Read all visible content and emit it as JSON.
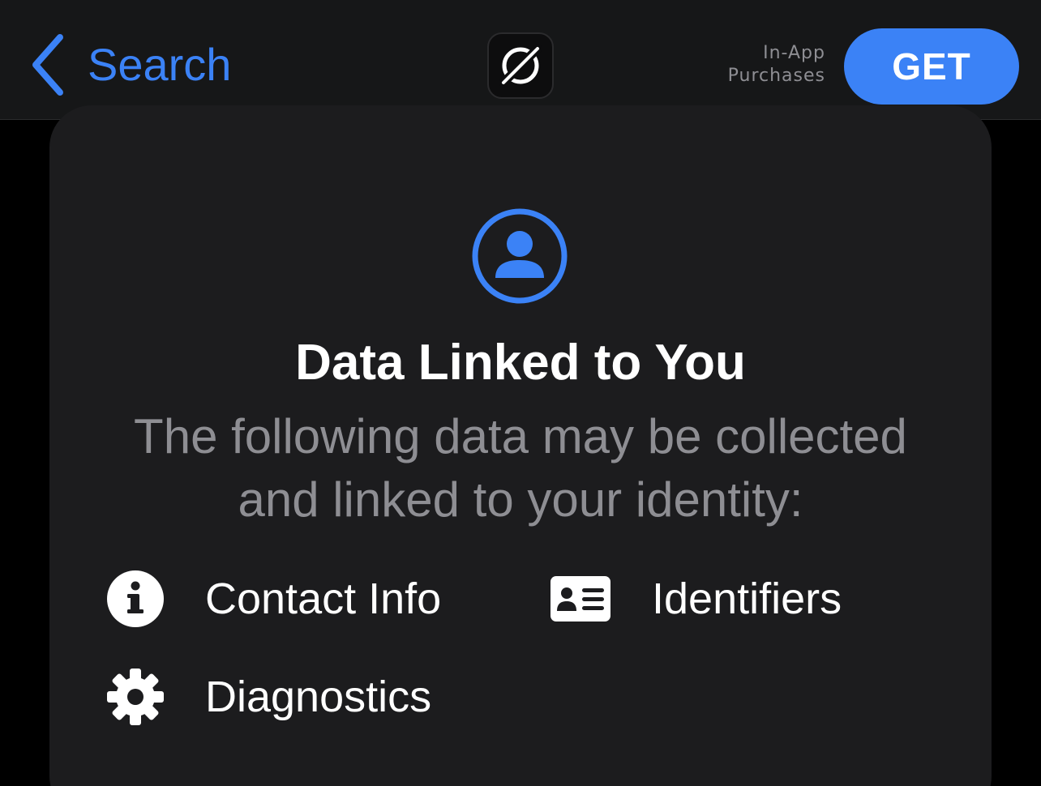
{
  "navbar": {
    "back_label": "Search",
    "back_icon": "chevron-left-icon",
    "app_icon": "no-symbol-app-icon",
    "iap_line1": "In-App",
    "iap_line2": "Purchases",
    "get_label": "GET"
  },
  "card": {
    "icon": "person-circle-icon",
    "title": "Data Linked to You",
    "subtitle": "The following data may be collected and linked to your identity:",
    "items": [
      {
        "label": "Contact Info",
        "icon": "info-circle-icon"
      },
      {
        "label": "Identifiers",
        "icon": "id-card-icon"
      },
      {
        "label": "Diagnostics",
        "icon": "gear-icon"
      }
    ]
  },
  "colors": {
    "accent": "#3b82f6",
    "background": "#000000",
    "navbar": "#161718",
    "card": "#1c1c1e",
    "secondary_text": "#8e8e93",
    "primary_text": "#ffffff"
  }
}
